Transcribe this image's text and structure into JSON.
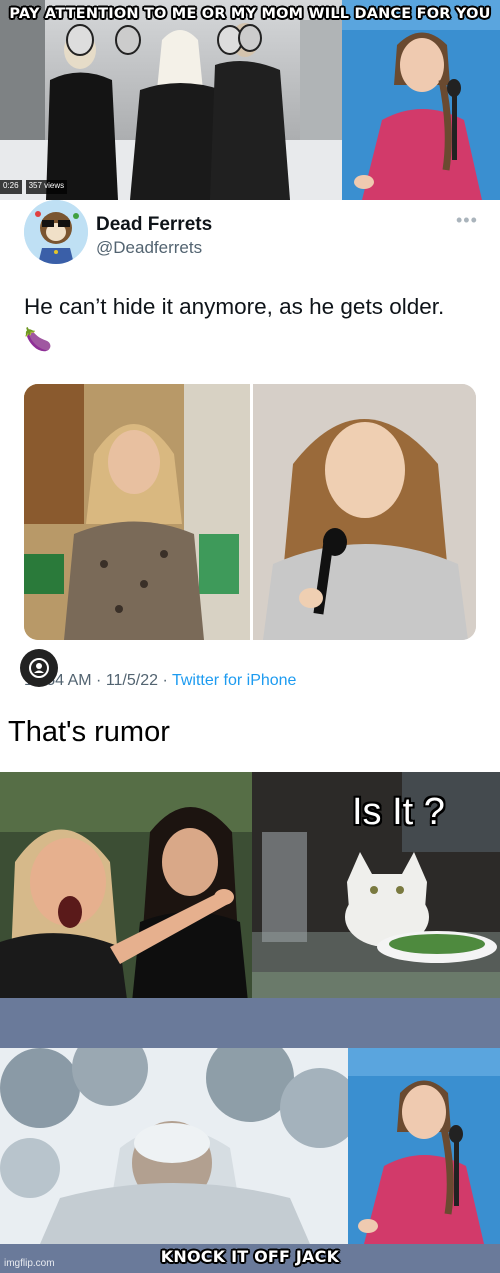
{
  "panel1": {
    "caption": "PAY ATTENTION TO ME OR MY MOM WILL DANCE FOR YOU",
    "video_time": "0:26",
    "video_views": "357 views"
  },
  "tweet": {
    "display_name": "Dead Ferrets",
    "handle": "@Deadferrets",
    "text": "He can’t hide it anymore, as he gets older. 🍆",
    "time_date": "10:54 AM · 11/5/22 · ",
    "source": "Twitter for iPhone",
    "source_color": "#1d9bf0"
  },
  "caption_rumor": "That's rumor",
  "panel_cat": {
    "caption": "Is It ?"
  },
  "panel_bottom": {
    "caption": "KNOCK IT OFF JACK"
  },
  "watermark": "imgflip.com"
}
